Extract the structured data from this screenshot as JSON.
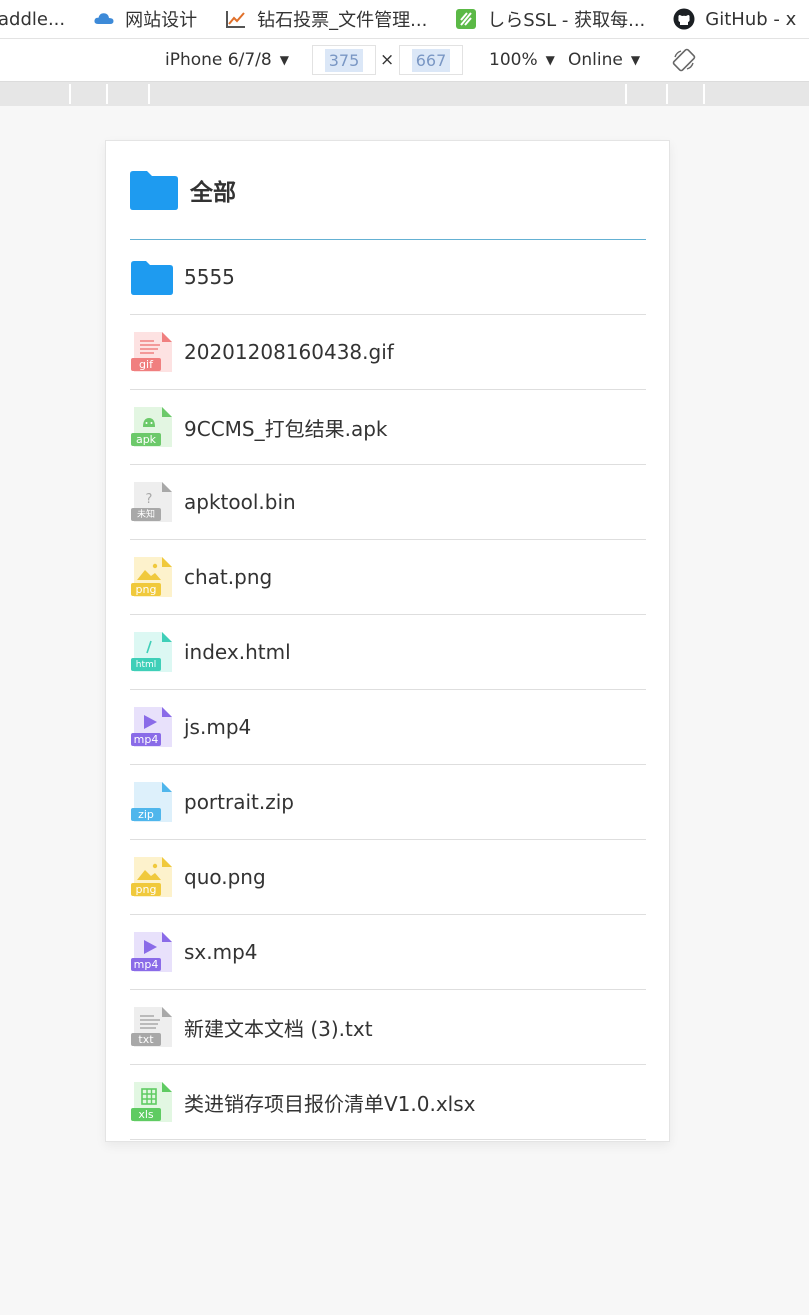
{
  "bookmarks": [
    {
      "label": "addle...",
      "icon": "none"
    },
    {
      "label": "网站设计",
      "icon": "cloud-icon"
    },
    {
      "label": "钻石投票_文件管理...",
      "icon": "chart-icon"
    },
    {
      "label": "しらSSL - 获取每...",
      "icon": "leaf-icon"
    },
    {
      "label": "GitHub - x",
      "icon": "github-icon"
    }
  ],
  "device_toolbar": {
    "device": "iPhone 6/7/8",
    "width": "375",
    "height": "667",
    "times": "×",
    "zoom": "100%",
    "network": "Online"
  },
  "colors": {
    "folder": "#1e9bf0",
    "accent_line": "#64b1d3"
  },
  "header": {
    "title": "全部"
  },
  "files": [
    {
      "name": "5555",
      "type": "folder",
      "ext": "",
      "color": "#1e9bf0",
      "bg": "#1e9bf0"
    },
    {
      "name": "20201208160438.gif",
      "type": "gif",
      "ext": "gif",
      "color": "#f07f7f",
      "bg": "#fde2e2"
    },
    {
      "name": "9CCMS_打包结果.apk",
      "type": "apk",
      "ext": "apk",
      "color": "#6cc96a",
      "bg": "#e3f6e2"
    },
    {
      "name": "apktool.bin",
      "type": "unknown",
      "ext": "未知",
      "color": "#a8a8a8",
      "bg": "#eeeeee"
    },
    {
      "name": "chat.png",
      "type": "png",
      "ext": "png",
      "color": "#f0c93c",
      "bg": "#fdf2cc"
    },
    {
      "name": "index.html",
      "type": "html",
      "ext": "html",
      "color": "#3fcfb8",
      "bg": "#dcf8f3"
    },
    {
      "name": "js.mp4",
      "type": "mp4",
      "ext": "mp4",
      "color": "#8a6be8",
      "bg": "#e8e1fb"
    },
    {
      "name": "portrait.zip",
      "type": "zip",
      "ext": "zip",
      "color": "#4fb6ec",
      "bg": "#ddf0fb"
    },
    {
      "name": "quo.png",
      "type": "png",
      "ext": "png",
      "color": "#f0c93c",
      "bg": "#fdf2cc"
    },
    {
      "name": "sx.mp4",
      "type": "mp4",
      "ext": "mp4",
      "color": "#8a6be8",
      "bg": "#e8e1fb"
    },
    {
      "name": "新建文本文档 (3).txt",
      "type": "txt",
      "ext": "txt",
      "color": "#a8a8a8",
      "bg": "#eeeeee"
    },
    {
      "name": "类进销存项目报价清单V1.0.xlsx",
      "type": "xls",
      "ext": "xls",
      "color": "#5fcb62",
      "bg": "#e2f7e2"
    }
  ]
}
